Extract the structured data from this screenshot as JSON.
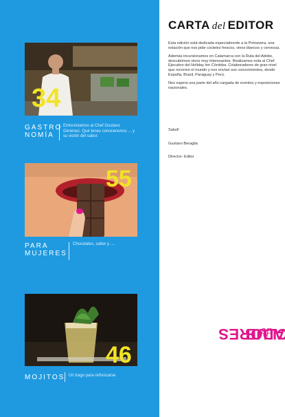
{
  "editor": {
    "title_part1": "CARTA",
    "title_script": "del",
    "title_part2": "EDITOR",
    "paragraphs": [
      "Esta edición está dedicada especialmente a la Primavera, una estación que nos pide cocteles frescos, vinos blancos y cervezas.",
      "Además incursionamos en Catamarca con la Ruta del Adobe, descubrimos vinos muy interesantes. Realizamos nota al Chef Ejecutivo del Holiday Inn Córdoba. Colaboradores de gran nivel que recorren el mundo y nos envían sus conocimientos, desde España, Brasil, Paraguay y Perú.",
      "Nos espera una parte del año cargada de eventos y exposiciones nacionales."
    ],
    "greeting": "Salud!",
    "signature_name": "Gustavo Beraglia",
    "signature_role": "Director- Editor"
  },
  "sections": [
    {
      "page_number": "34",
      "title_line1": "GASTRO",
      "title_line2": "NOMÍA",
      "description": "Entrevistamos al Chef Gustavo Giménez. Qué tenes conoceremos ... y su visión del sabor."
    },
    {
      "page_number": "55",
      "title_line1": "PARA",
      "title_line2": "MUJERES",
      "description": "Chocolates, sabor y ...."
    },
    {
      "page_number": "46",
      "title_line1": "MOJITOS",
      "title_line2": "",
      "description": "Un trago para refrescarse"
    }
  ],
  "brand": {
    "part1": "CLUB",
    "script": "de",
    "part2": "CATADORES"
  },
  "colors": {
    "left_panel": "#1f9ae0",
    "page_number": "#f2e326",
    "brand": "#e0168d"
  }
}
